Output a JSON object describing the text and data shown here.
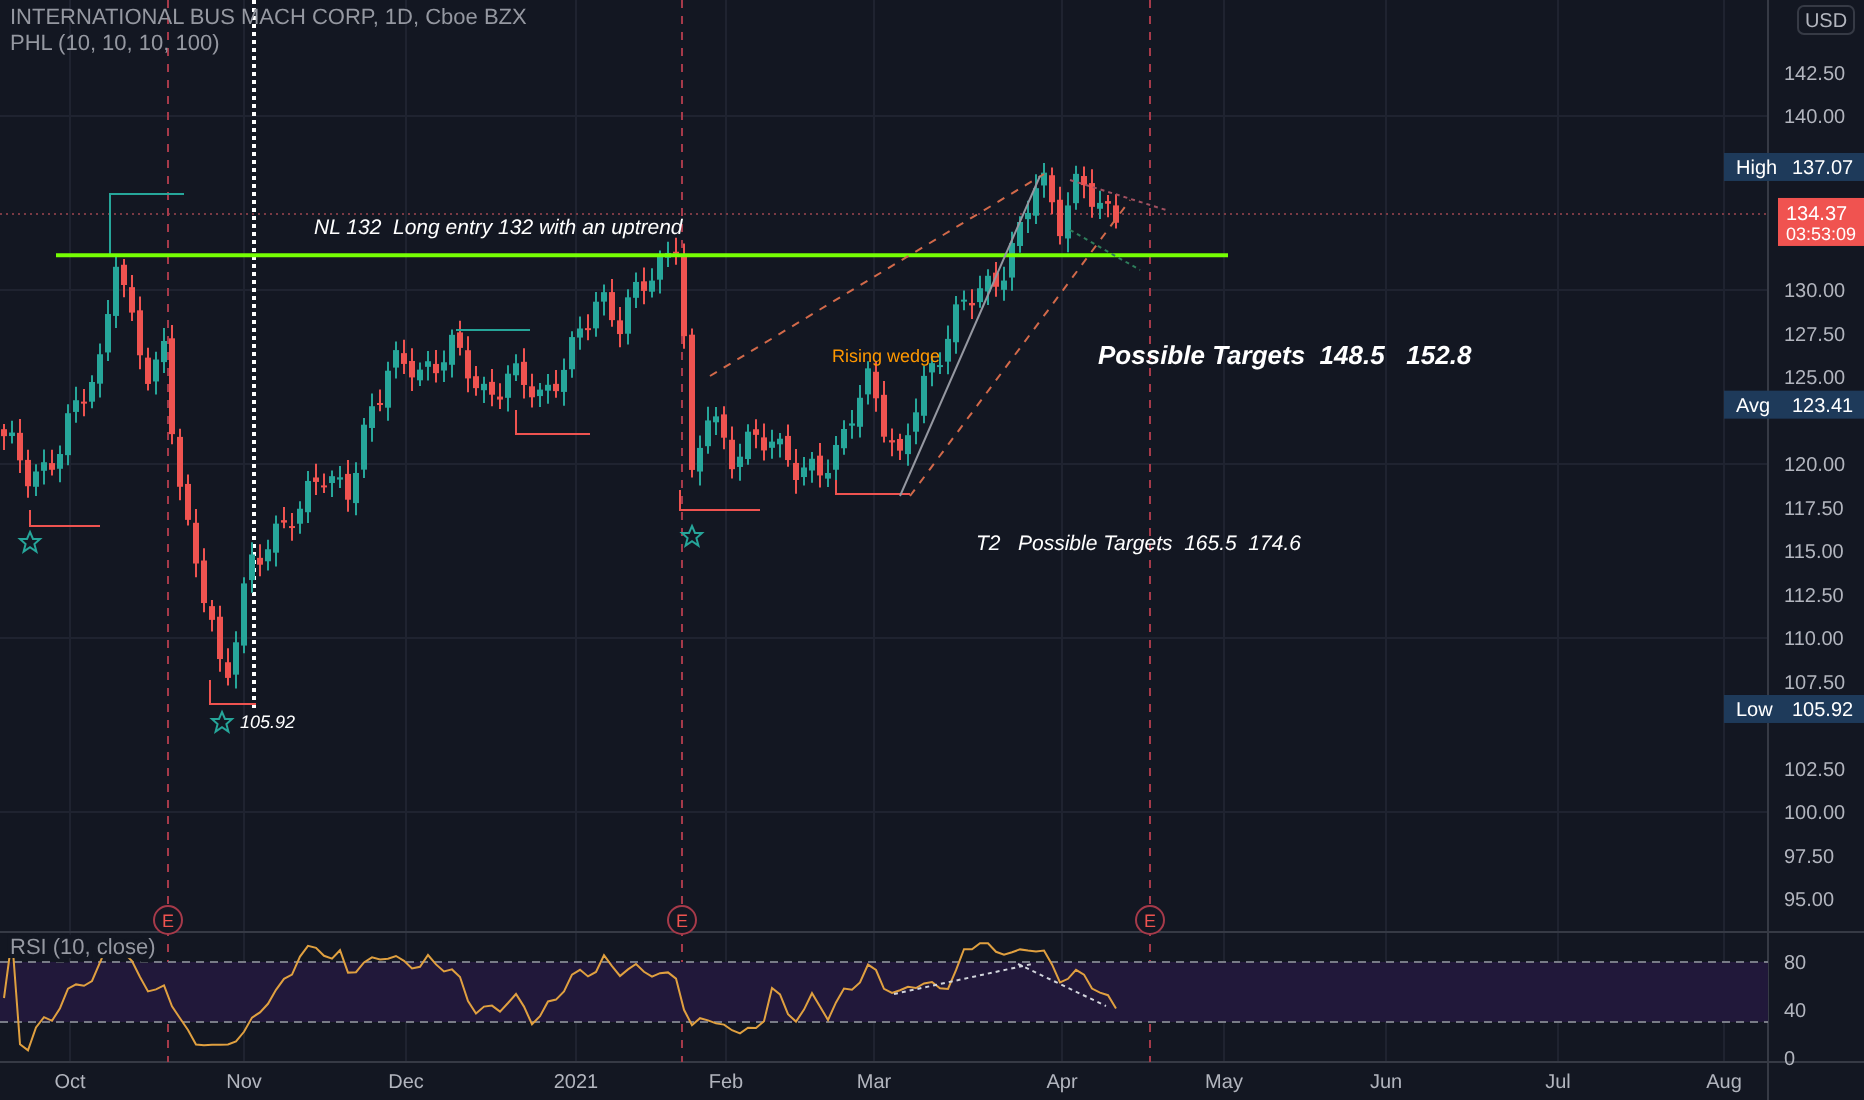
{
  "header": {
    "title": "INTERNATIONAL BUS MACH CORP, 1D, Cboe BZX",
    "indicator": "PHL (10, 10, 10, 100)"
  },
  "price_axis": {
    "currency": "USD",
    "ticks": [
      "142.50",
      "140.00",
      "130.00",
      "127.50",
      "125.00",
      "120.00",
      "117.50",
      "115.00",
      "112.50",
      "110.00",
      "107.50",
      "102.50",
      "100.00",
      "97.50",
      "95.00"
    ]
  },
  "price_markers": [
    {
      "kind": "label",
      "label": "High",
      "value": "137.07"
    },
    {
      "kind": "last",
      "value": "134.37",
      "countdown": "03:53:09"
    },
    {
      "kind": "label",
      "label": "Avg",
      "value": "123.41"
    },
    {
      "kind": "label",
      "label": "Low",
      "value": "105.92"
    }
  ],
  "annotations": [
    {
      "kind": "note",
      "text": "NL 132  Long entry 132 with an uptrend"
    },
    {
      "kind": "wedge",
      "text": "Rising wedge"
    },
    {
      "kind": "target",
      "text": "Possible Targets  148.5   152.8"
    },
    {
      "kind": "note",
      "text": "T2   Possible Targets  165.5  174.6"
    },
    {
      "kind": "low",
      "text": "105.92"
    }
  ],
  "earnings_markers": [
    "E",
    "E",
    "E"
  ],
  "rsi": {
    "legend": "RSI (10, close)",
    "ticks": [
      "80",
      "40",
      "0"
    ]
  },
  "time_axis": [
    "Oct",
    "Nov",
    "Dec",
    "2021",
    "Feb",
    "Mar",
    "Apr",
    "May",
    "Jun",
    "Jul",
    "Aug"
  ]
}
